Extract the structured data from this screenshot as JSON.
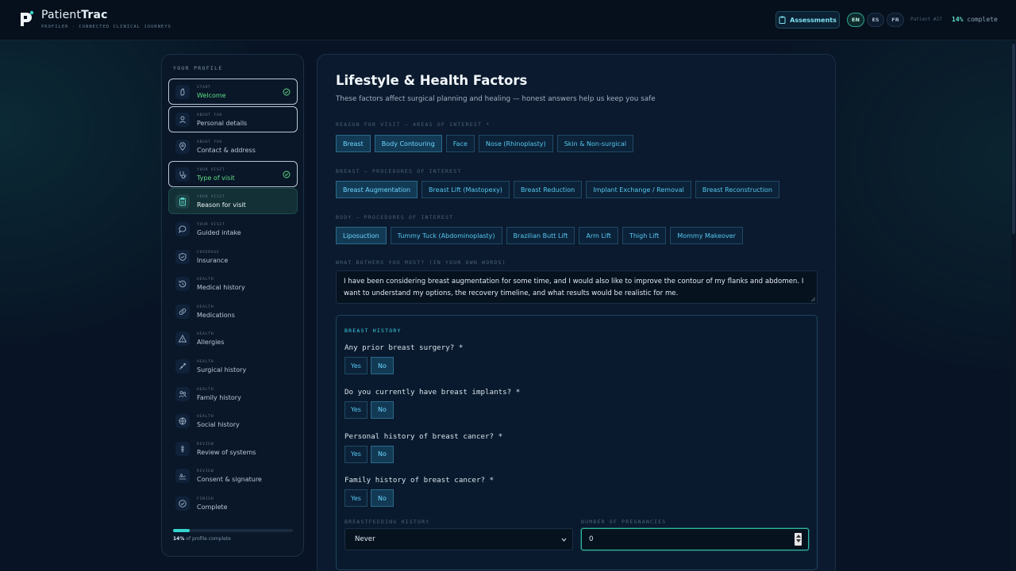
{
  "header": {
    "brand_light": "Patient",
    "brand_bold": "Trac",
    "brand_sub": "PROFILER · CONNECTED CLINICAL JOURNEYS",
    "assessments_label": "Assessments",
    "languages": [
      "EN",
      "ES",
      "FR"
    ],
    "active_language": "EN",
    "patient_label": "Patient #27",
    "percent": "14%",
    "percent_suffix": "complete"
  },
  "sidebar": {
    "title": "YOUR PROFILE",
    "steps": [
      {
        "cat": "START",
        "label": "Welcome",
        "state": "done",
        "icon": "hand-wave-icon"
      },
      {
        "cat": "ABOUT YOU",
        "label": "Personal details",
        "state": "outlined",
        "icon": "user-icon"
      },
      {
        "cat": "ABOUT YOU",
        "label": "Contact & address",
        "state": "",
        "icon": "map-pin-icon"
      },
      {
        "cat": "YOUR VISIT",
        "label": "Type of visit",
        "state": "done",
        "icon": "stethoscope-icon"
      },
      {
        "cat": "YOUR VISIT",
        "label": "Reason for visit",
        "state": "active",
        "icon": "clipboard-icon"
      },
      {
        "cat": "YOUR VISIT",
        "label": "Guided intake",
        "state": "",
        "icon": "chat-icon"
      },
      {
        "cat": "COVERAGE",
        "label": "Insurance",
        "state": "",
        "icon": "shield-icon"
      },
      {
        "cat": "HEALTH",
        "label": "Medical history",
        "state": "",
        "icon": "history-icon"
      },
      {
        "cat": "HEALTH",
        "label": "Medications",
        "state": "",
        "icon": "pill-icon"
      },
      {
        "cat": "HEALTH",
        "label": "Allergies",
        "state": "",
        "icon": "warning-icon"
      },
      {
        "cat": "HEALTH",
        "label": "Surgical history",
        "state": "",
        "icon": "syringe-icon"
      },
      {
        "cat": "HEALTH",
        "label": "Family history",
        "state": "",
        "icon": "users-icon"
      },
      {
        "cat": "HEALTH",
        "label": "Social history",
        "state": "",
        "icon": "globe-icon"
      },
      {
        "cat": "REVIEW",
        "label": "Review of systems",
        "state": "",
        "icon": "body-icon"
      },
      {
        "cat": "REVIEW",
        "label": "Consent & signature",
        "state": "",
        "icon": "signature-icon"
      },
      {
        "cat": "FINISH",
        "label": "Complete",
        "state": "",
        "icon": "check-circle-icon"
      }
    ],
    "progress": 0.14,
    "progress_pct": "14%",
    "progress_suffix": " of profile complete"
  },
  "main": {
    "title": "Lifestyle & Health Factors",
    "subtitle": "These factors affect surgical planning and healing — honest answers help us keep you safe",
    "areas": {
      "label": "REASON FOR VISIT — AREAS OF INTEREST *",
      "chips": [
        {
          "label": "Breast",
          "selected": true
        },
        {
          "label": "Body Contouring",
          "selected": true
        },
        {
          "label": "Face",
          "selected": false
        },
        {
          "label": "Nose (Rhinoplasty)",
          "selected": false
        },
        {
          "label": "Skin & Non-surgical",
          "selected": false
        }
      ]
    },
    "breast_procedures": {
      "label": "BREAST — PROCEDURES OF INTEREST",
      "chips": [
        {
          "label": "Breast Augmentation",
          "selected": true
        },
        {
          "label": "Breast Lift (Mastopexy)",
          "selected": false
        },
        {
          "label": "Breast Reduction",
          "selected": false
        },
        {
          "label": "Implant Exchange / Removal",
          "selected": false
        },
        {
          "label": "Breast Reconstruction",
          "selected": false
        }
      ]
    },
    "body_procedures": {
      "label": "BODY — PROCEDURES OF INTEREST",
      "chips": [
        {
          "label": "Liposuction",
          "selected": true
        },
        {
          "label": "Tummy Tuck (Abdominoplasty)",
          "selected": false
        },
        {
          "label": "Brazilian Butt Lift",
          "selected": false
        },
        {
          "label": "Arm Lift",
          "selected": false
        },
        {
          "label": "Thigh Lift",
          "selected": false
        },
        {
          "label": "Mommy Makeover",
          "selected": false
        }
      ]
    },
    "bothers": {
      "label": "WHAT BOTHERS YOU MOST? (IN YOUR OWN WORDS)",
      "value": "I have been considering breast augmentation for some time, and I would also like to improve the contour of my flanks and abdomen. I want to understand my options, the recovery timeline, and what results would be realistic for me."
    },
    "breast_history": {
      "title": "BREAST HISTORY",
      "questions": [
        {
          "text": "Any prior breast surgery? *",
          "yes": "Yes",
          "no": "No",
          "answer": "No"
        },
        {
          "text": "Do you currently have breast implants? *",
          "yes": "Yes",
          "no": "No",
          "answer": "No"
        },
        {
          "text": "Personal history of breast cancer? *",
          "yes": "Yes",
          "no": "No",
          "answer": "No"
        },
        {
          "text": "Family history of breast cancer? *",
          "yes": "Yes",
          "no": "No",
          "answer": "No"
        }
      ],
      "breastfeeding_label": "BREASTFEEDING HISTORY",
      "breastfeeding_value": "Never",
      "pregnancies_label": "NUMBER OF PREGNANCIES",
      "pregnancies_value": "0"
    }
  },
  "colors": {
    "accent": "#35d6cf",
    "chip_text": "#55c7ee",
    "done_green": "#5fdc84"
  }
}
